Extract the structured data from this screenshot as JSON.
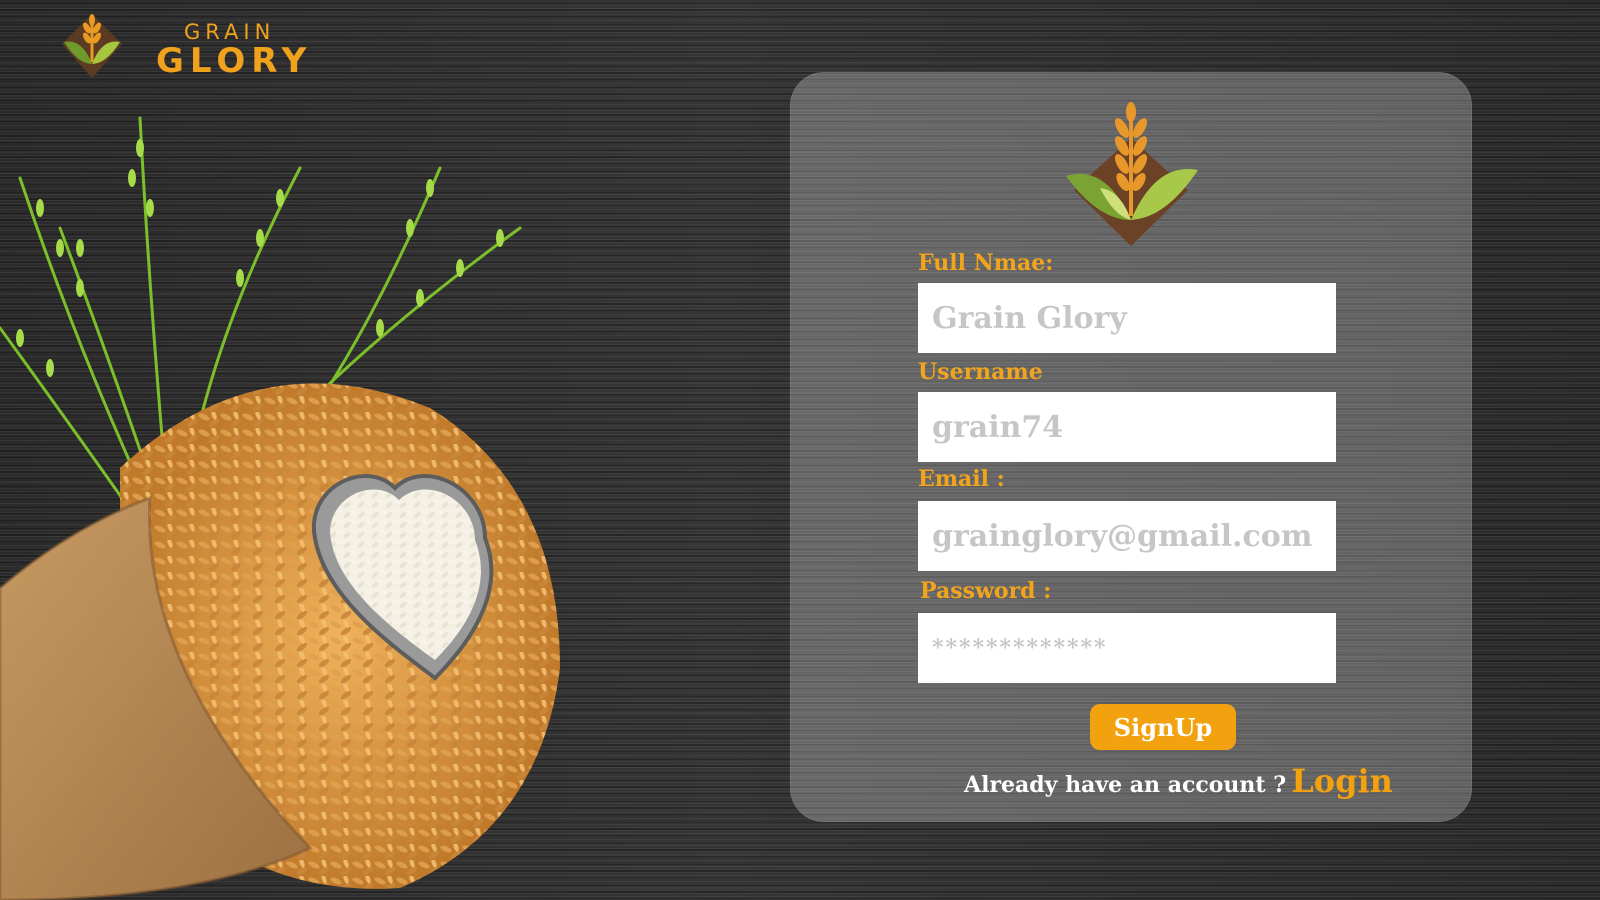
{
  "brand": {
    "line1": "GRAIN",
    "line2": "GLORY",
    "icon": "wheat-logo-icon"
  },
  "hero": {
    "icon": "rice-sack-illustration"
  },
  "form": {
    "logo_icon": "wheat-emblem-icon",
    "full_name": {
      "label": "Full Nmae:",
      "placeholder": "Grain Glory"
    },
    "username": {
      "label": "Username",
      "placeholder": "grain74"
    },
    "email": {
      "label": "Email :",
      "placeholder": "grainglory@gmail.com"
    },
    "password": {
      "label": "Password :",
      "placeholder": "*************"
    },
    "signup_label": "SignUp",
    "login_prompt": "Already have an account ?",
    "login_label": "Login"
  },
  "colors": {
    "accent": "#f2a10f",
    "wheat_brown": "#6b4226",
    "leaf_green": "#8ab43c",
    "card_overlay": "rgba(255,255,255,0.26)"
  }
}
